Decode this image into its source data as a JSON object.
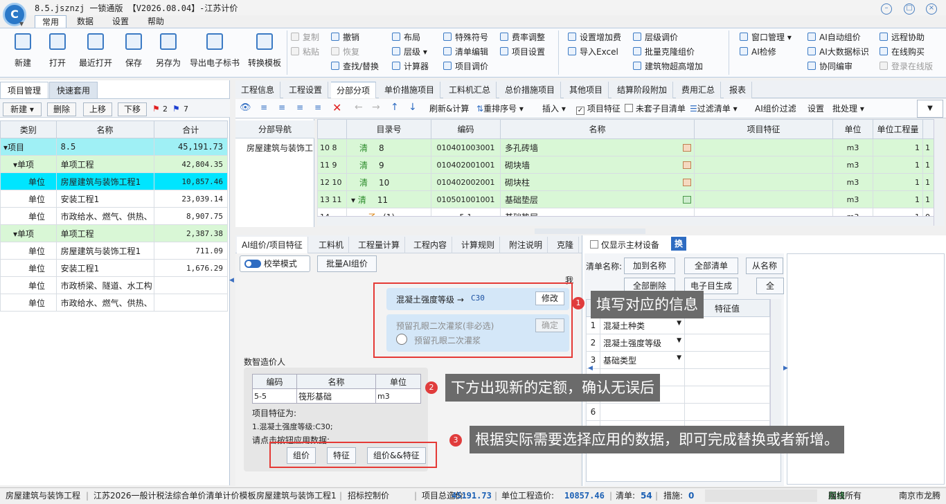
{
  "window": {
    "title": "8.5.jsznzj 一锁通版 【V2026.08.04】-江苏计价",
    "logo_letter": "C"
  },
  "menu_tabs": [
    "常用",
    "数据",
    "设置",
    "帮助"
  ],
  "ribbon": {
    "big_buttons": [
      "新建",
      "打开",
      "最近打开",
      "保存",
      "另存为",
      "导出电子标书",
      "转换模板"
    ],
    "edit_col1": [
      "复制",
      "粘贴"
    ],
    "edit_col2": [
      "撤销",
      "恢复",
      "查找/替换"
    ],
    "col3": [
      "布局",
      "层级",
      "计算器"
    ],
    "col4": [
      "特殊符号",
      "清单编辑",
      "项目调价"
    ],
    "col5": [
      "费率调整",
      "项目设置"
    ],
    "col6": [
      "设置增加费",
      "导入Excel"
    ],
    "col7": [
      "层级调价",
      "批量克隆组价",
      "建筑物超高增加"
    ],
    "col8": [
      "窗口管理",
      "AI检修"
    ],
    "col9": [
      "AI自动组价",
      "AI大数据标识",
      "协同编审"
    ],
    "col10": [
      "远程协助",
      "在线购买",
      "登录在线版"
    ]
  },
  "left_panel": {
    "tabs": [
      "项目管理",
      "快速套用"
    ],
    "toolbar": {
      "new": "新建",
      "delete": "删除",
      "up": "上移",
      "down": "下移",
      "red_count": "2",
      "blue_count": "7"
    },
    "headers": [
      "类别",
      "名称",
      "合计"
    ],
    "rows": [
      {
        "type": "项目",
        "name": "8.5",
        "total": "45,191.73"
      },
      {
        "type": "单项",
        "name": "单项工程",
        "total": "42,804.35"
      },
      {
        "type": "单位",
        "name": "房屋建筑与装饰工程1",
        "total": "10,857.46"
      },
      {
        "type": "单位",
        "name": "安装工程1",
        "total": "23,039.14"
      },
      {
        "type": "单位",
        "name": "市政给水、燃气、供热、",
        "total": "8,907.75"
      },
      {
        "type": "单项",
        "name": "单项工程",
        "total": "2,387.38"
      },
      {
        "type": "单位",
        "name": "房屋建筑与装饰工程1",
        "total": "711.09"
      },
      {
        "type": "单位",
        "name": "安装工程1",
        "total": "1,676.29"
      },
      {
        "type": "单位",
        "name": "市政桥梁、隧道、水工构",
        "total": ""
      },
      {
        "type": "单位",
        "name": "市政给水、燃气、供热、",
        "total": ""
      }
    ]
  },
  "right_tabs": [
    "工程信息",
    "工程设置",
    "分部分项",
    "单价措施项目",
    "工料机汇总",
    "总价措施项目",
    "其他项目",
    "结算阶段附加",
    "费用汇总",
    "报表"
  ],
  "toolbar2": {
    "refresh": "刷新&计算",
    "reorder": "重排序号",
    "insert": "插入",
    "feature": "项目特征",
    "unmatched": "未套子目清单",
    "filter": "过滤清单",
    "ai_filter": "AI组价过滤",
    "settings": "设置",
    "batch": "批处理"
  },
  "nav": {
    "header": "分部导航",
    "item": "房屋建筑与装饰工"
  },
  "grid": {
    "headers": [
      "目录号",
      "编码",
      "名称",
      "项目特征",
      "单位",
      "单位工程量"
    ],
    "rows": [
      {
        "idx": "10",
        "no": "8",
        "kind": "清",
        "dir": "8",
        "code": "010401003001",
        "name": "多孔砖墙",
        "unit": "m3",
        "qty": "1",
        "q2": "1"
      },
      {
        "idx": "11",
        "no": "9",
        "kind": "清",
        "dir": "9",
        "code": "010402001001",
        "name": "砌块墙",
        "unit": "m3",
        "qty": "1",
        "q2": "1"
      },
      {
        "idx": "12",
        "no": "10",
        "kind": "清",
        "dir": "10",
        "code": "010402002001",
        "name": "砌块柱",
        "unit": "m3",
        "qty": "1",
        "q2": "1"
      },
      {
        "idx": "13",
        "no": "11",
        "kind": "清",
        "dir": "11",
        "code": "010501001001",
        "name": "基础垫层",
        "unit": "m3",
        "qty": "1",
        "q2": "1"
      },
      {
        "idx": "14",
        "no": "",
        "kind": "子",
        "dir": "(1)",
        "code": "5-1",
        "name": "基础垫层",
        "unit": "m3",
        "qty": "1",
        "q2": "0"
      }
    ]
  },
  "bottom_tabs": [
    "AI组价/项目特征",
    "工料机",
    "工程量计算",
    "工程内容",
    "计算规则",
    "附注说明",
    "克隆"
  ],
  "ai_panel": {
    "mode_toggle": "校举模式",
    "batch_btn": "批量AI组价",
    "me_label": "我",
    "field1_label": "混凝土强度等级 →",
    "field1_value": "C30",
    "modify_btn": "修改",
    "field2_label": "预留孔眼二次灌浆(非必选)",
    "confirm_btn": "确定",
    "field2_option": "预留孔眼二次灌浆",
    "bot_name": "数智造价人",
    "quota_headers": [
      "编码",
      "名称",
      "单位"
    ],
    "quota_row": [
      "5-5",
      "筏形基础",
      "m3"
    ],
    "feature_title": "项目特征为:",
    "feature_line": "1.混凝土强度等级:C30;",
    "hint": "请点击按钮应用数据:",
    "apply_btns": [
      "组价",
      "特征",
      "组价&&特征"
    ]
  },
  "feature_panel": {
    "main_only": "仅显示主材设备",
    "swap": "换",
    "list_name_label": "清单名称:",
    "btns_row1": [
      "加到名称",
      "全部清单",
      "从名称"
    ],
    "btns_row2": [
      "全部删除",
      "电子目生成",
      "全由"
    ],
    "col_value": "特征值",
    "rows": [
      "混凝土种类",
      "混凝土强度等级",
      "基础类型",
      "",
      "",
      "",
      ""
    ]
  },
  "callouts": [
    {
      "num": "1",
      "text": "填写对应的信息"
    },
    {
      "num": "2",
      "text": "下方出现新的定额，确认无误后"
    },
    {
      "num": "3",
      "text": "根据实际需要选择应用的数据，即可完成替换或者新增。"
    }
  ],
  "status": {
    "s1": "房屋建筑与装饰工程",
    "s2": "江苏2026一般计税法综合单价清单计价模板",
    "s3": "房屋建筑与装饰工程1",
    "s4": "招标控制价",
    "total_label": "项目总造价:",
    "total": "45191.73",
    "unit_label": "单位工程造价:",
    "unit_total": "10857.46",
    "list_label": "清单:",
    "list_count": "54",
    "measure_label": "措施:",
    "measure_count": "0",
    "net_pre": "网络",
    "net_online": "在线",
    "net_post": "版权所有",
    "company": "南京市龙腾"
  },
  "colors": {
    "accent": "#3b7ac4",
    "selected_row": "#00e5ff",
    "project_row": "#9ff0f5",
    "green_row": "#d9f7d6",
    "callout_bg": "#6b6b6b",
    "marker_red": "#e03c3c"
  }
}
